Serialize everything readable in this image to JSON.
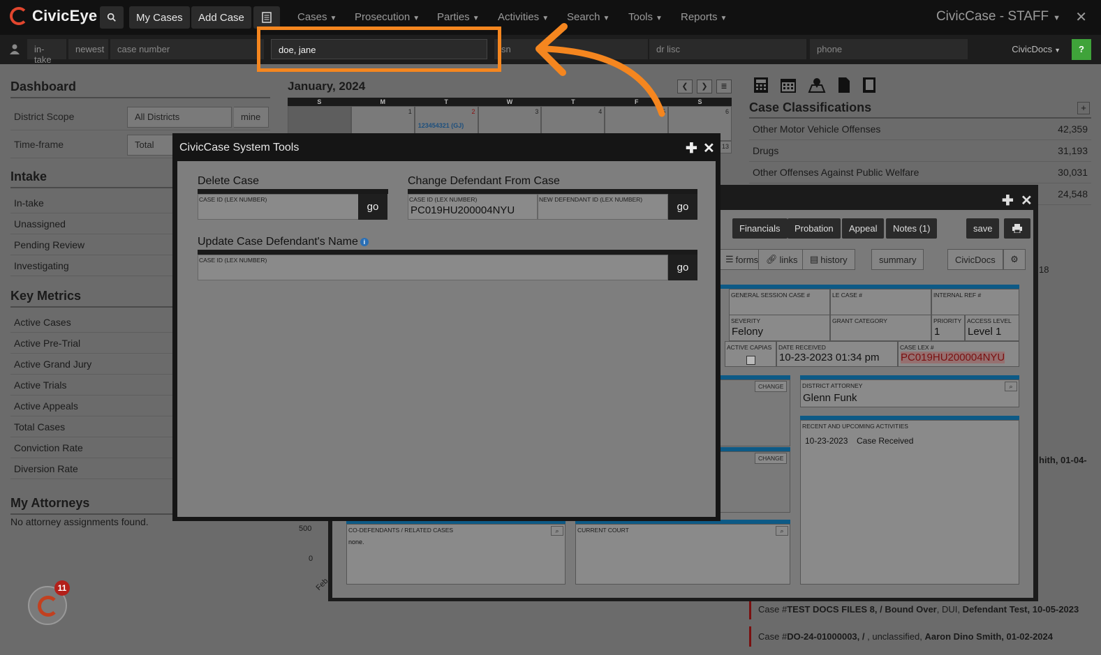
{
  "nav": {
    "brand": "CivicEye",
    "my_cases": "My Cases",
    "add_case": "Add Case",
    "menus": [
      "Cases",
      "Prosecution",
      "Parties",
      "Activities",
      "Search",
      "Tools",
      "Reports"
    ],
    "app_title": "CivicCase - STAFF",
    "close": "✕"
  },
  "subbar": {
    "intake": "in-take",
    "newest": "newest",
    "case_number_placeholder": "case number",
    "name_value": "doe, jane",
    "ssn_placeholder": "sn",
    "dr_lisc_placeholder": "dr lisc",
    "phone_placeholder": "phone",
    "civicdocs": "CivicDocs",
    "help": "?"
  },
  "dashboard": {
    "title": "Dashboard",
    "district_label": "District Scope",
    "district_value": "All Districts",
    "mine": "mine",
    "timeframe_label": "Time-frame",
    "timeframe_value": "Total",
    "intake_title": "Intake",
    "intake_items": [
      "In-take",
      "Unassigned",
      "Pending Review",
      "Investigating"
    ],
    "metrics_title": "Key Metrics",
    "metrics_items": [
      "Active Cases",
      "Active Pre-Trial",
      "Active Grand Jury",
      "Active Trials",
      "Active Appeals",
      "Total Cases",
      "Conviction Rate",
      "Diversion Rate"
    ],
    "attorneys_title": "My Attorneys",
    "attorneys_empty": "No attorney assignments found."
  },
  "calendar": {
    "title": "January, 2024",
    "days": [
      "S",
      "M",
      "T",
      "W",
      "T",
      "F",
      "S"
    ],
    "row1": [
      "",
      "1",
      "2",
      "3",
      "4",
      "5",
      "6"
    ],
    "event": "123454321 (GJ)",
    "cell_13": "13",
    "axis_500": "500",
    "axis_0": "0",
    "axis_feb": "Feb"
  },
  "classifications": {
    "title": "Case Classifications",
    "plus": "+",
    "rows": [
      {
        "name": "Other Motor Vehicle Offenses",
        "count": "42,359"
      },
      {
        "name": "Drugs",
        "count": "31,193"
      },
      {
        "name": "Other Offenses Against Public Welfare",
        "count": "30,031"
      },
      {
        "name": "",
        "count": "24,548"
      }
    ],
    "frag_18": "18",
    "frag_smith": "hith, 01-04-"
  },
  "recent": [
    {
      "prefix": "Case #",
      "case": "TEST DOCS FILES 8, / Bound Over",
      "mid": ", DUI, ",
      "party": "Defendant Test, 10-05-2023"
    },
    {
      "prefix": "Case #",
      "case": "DO-24-01000003, /",
      "mid": " , unclassified, ",
      "party": "Aaron Dino Smith, 01-02-2024"
    }
  ],
  "notifications": {
    "count": "11"
  },
  "case_modal": {
    "tabs": [
      "Financials",
      "Probation",
      "Appeal",
      "Notes (1)"
    ],
    "save": "save",
    "buttons": [
      "forms",
      "links",
      "history",
      "summary",
      "CivicDocs"
    ],
    "fields": {
      "general_session_label": "GENERAL SESSION CASE #",
      "le_case_label": "LE CASE #",
      "internal_ref_label": "INTERNAL REF #",
      "severity_label": "SEVERITY",
      "severity_value": "Felony",
      "grant_label": "GRANT CATEGORY",
      "priority_label": "PRIORITY",
      "priority_value": "1",
      "access_label": "ACCESS LEVEL",
      "access_value": "Level 1",
      "capias_label": "ACTIVE CAPIAS",
      "received_label": "DATE RECEIVED",
      "received_value": "10-23-2023 01:34 pm",
      "lex_label": "CASE LEX #",
      "lex_value": "PC019HU200004NYU",
      "da_label": "DISTRICT ATTORNEY",
      "da_value": "Glenn Funk",
      "activities_label": "RECENT AND UPCOMING ACTIVITIES",
      "activity_date": "10-23-2023",
      "activity_text": "Case Received",
      "codef_label": "CO-DEFENDANTS / RELATED CASES",
      "codef_value": "none.",
      "court_label": "CURRENT COURT",
      "change": "CHANGE"
    }
  },
  "tools_modal": {
    "title": "CivicCase System Tools",
    "delete_title": "Delete Case",
    "change_title": "Change Defendant From Case",
    "update_title": "Update Case Defendant's Name",
    "case_id_label": "CASE ID (LEX NUMBER)",
    "new_def_label": "NEW DEFENDANT ID (LEX NUMBER)",
    "change_case_value": "PC019HU200004NYU",
    "go": "go"
  },
  "colors": {
    "accent": "#f5861f",
    "brand": "#e2462e",
    "header_blue": "#0d5a86",
    "help_green": "#3fa33a"
  }
}
